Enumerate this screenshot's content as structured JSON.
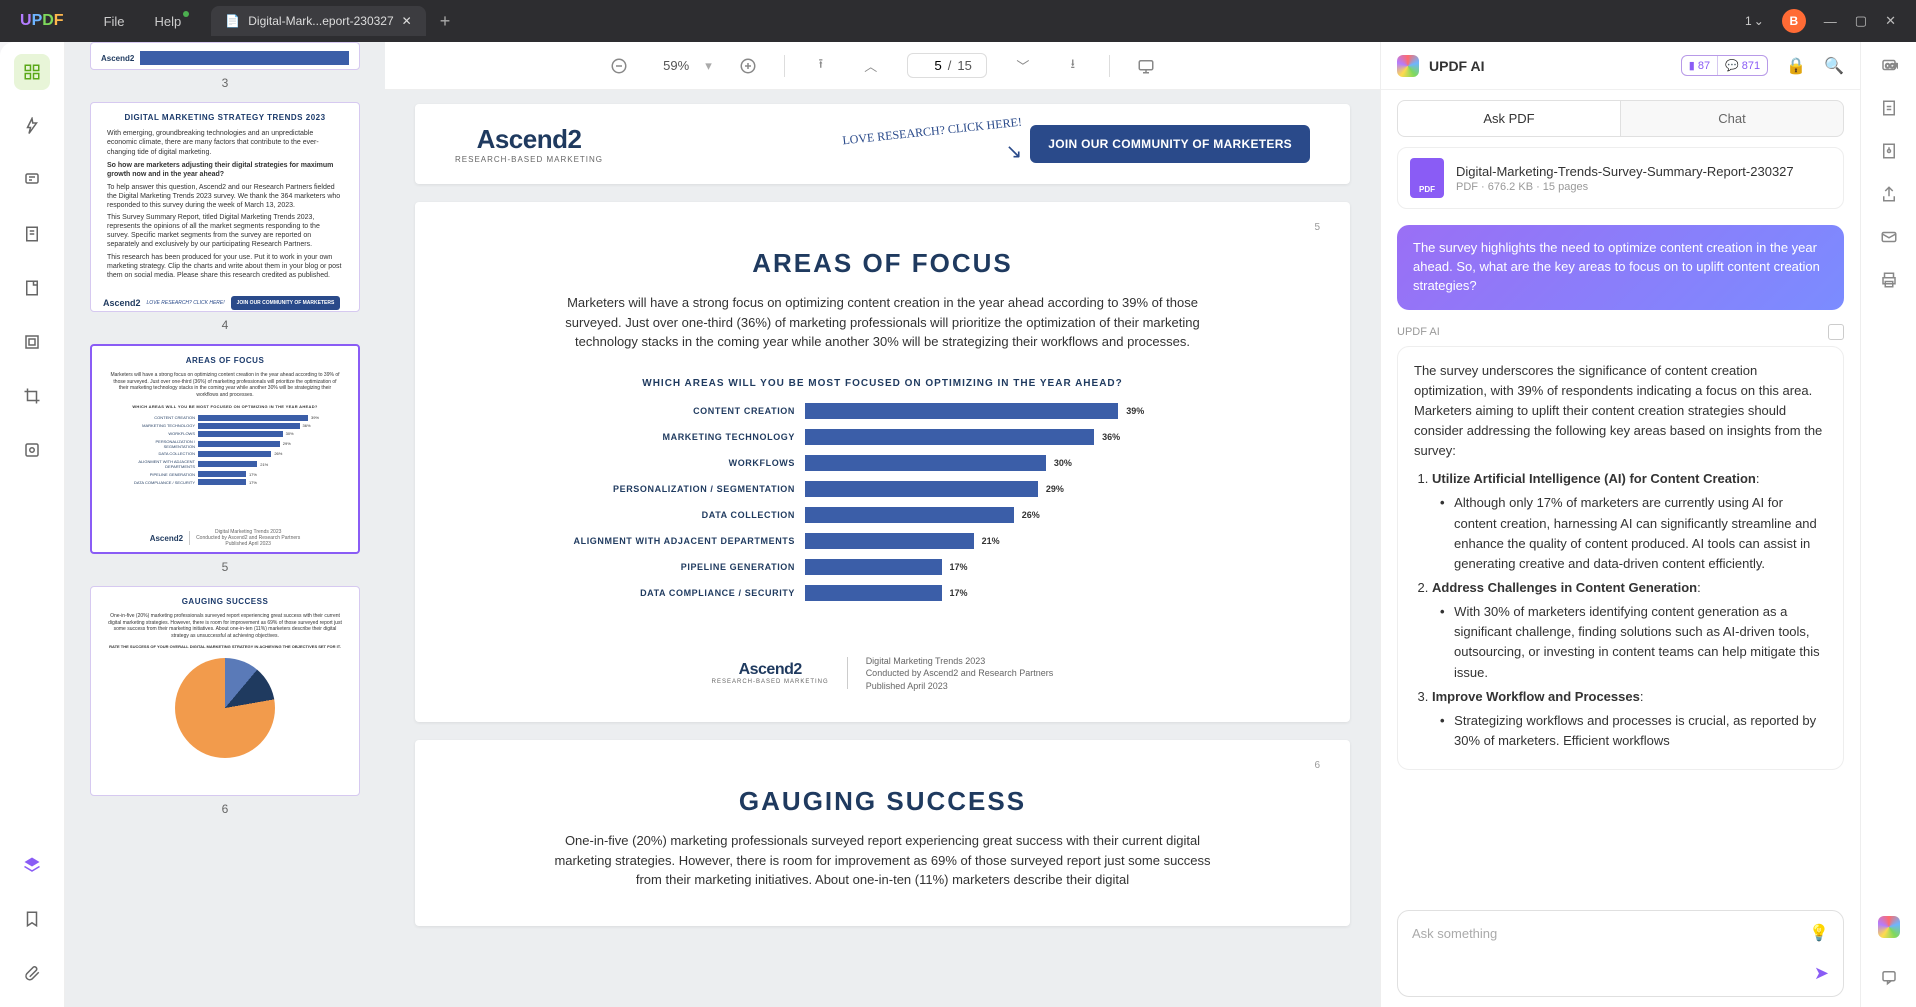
{
  "titlebar": {
    "menu": [
      "File",
      "Help"
    ],
    "tab_name": "Digital-Mark...eport-230327",
    "badge_num": "1",
    "avatar": "B"
  },
  "toolbar": {
    "zoom": "59%",
    "page_current": "5",
    "page_total": "15"
  },
  "thumbs": [
    {
      "num": "3"
    },
    {
      "num": "4",
      "title": "DIGITAL MARKETING STRATEGY TRENDS 2023"
    },
    {
      "num": "5",
      "title": "AREAS OF FOCUS"
    },
    {
      "num": "6",
      "title": "GAUGING SUCCESS"
    }
  ],
  "doc": {
    "ascend_name": "Ascend2",
    "ascend_sub": "RESEARCH-BASED MARKETING",
    "cta_script": "LOVE RESEARCH? CLICK HERE!",
    "cta_button": "JOIN OUR COMMUNITY OF MARKETERS",
    "page5": {
      "num": "5",
      "title": "AREAS OF FOCUS",
      "body": "Marketers will have a strong focus on optimizing content creation in the year ahead according to 39% of those surveyed. Just over one-third (36%) of marketing professionals will prioritize the optimization of their marketing technology stacks in the coming year while another 30% will be strategizing their workflows and processes.",
      "chart_title": "WHICH AREAS WILL YOU BE MOST FOCUSED ON OPTIMIZING IN THE YEAR AHEAD?",
      "footer": {
        "l1": "Digital Marketing Trends 2023",
        "l2": "Conducted by Ascend2 and Research Partners",
        "l3": "Published April 2023"
      }
    },
    "page6": {
      "num": "6",
      "title": "GAUGING SUCCESS",
      "body": "One-in-five (20%) marketing professionals surveyed report experiencing great success with their current digital marketing strategies. However, there is room for improvement as 69% of those surveyed report just some success from their marketing initiatives. About one-in-ten (11%) marketers describe their digital"
    }
  },
  "chart_data": {
    "type": "bar",
    "orientation": "horizontal",
    "title": "WHICH AREAS WILL YOU BE MOST FOCUSED ON OPTIMIZING IN THE YEAR AHEAD?",
    "categories": [
      "CONTENT CREATION",
      "MARKETING TECHNOLOGY",
      "WORKFLOWS",
      "PERSONALIZATION / SEGMENTATION",
      "DATA COLLECTION",
      "ALIGNMENT WITH ADJACENT DEPARTMENTS",
      "PIPELINE GENERATION",
      "DATA COMPLIANCE / SECURITY"
    ],
    "values": [
      39,
      36,
      30,
      29,
      26,
      21,
      17,
      17
    ],
    "value_labels": [
      "39%",
      "36%",
      "30%",
      "29%",
      "26%",
      "21%",
      "17%",
      "17%"
    ],
    "xlabel": "",
    "ylabel": "",
    "xlim": [
      0,
      40
    ]
  },
  "ai": {
    "title": "UPDF AI",
    "credit1": "87",
    "credit2": "871",
    "tabs": [
      "Ask PDF",
      "Chat"
    ],
    "file_name": "Digital-Marketing-Trends-Survey-Summary-Report-230327",
    "file_meta": "PDF · 676.2 KB · 15 pages",
    "user_msg": "The survey highlights the need to optimize content creation in the year ahead. So, what are the key areas to focus on to uplift content creation strategies?",
    "ai_label": "UPDF AI",
    "ai_intro": "The survey underscores the significance of content creation optimization, with 39% of respondents indicating a focus on this area. Marketers aiming to uplift their content creation strategies should consider addressing the following key areas based on insights from the survey:",
    "points": [
      {
        "title": "Utilize Artificial Intelligence (AI) for Content Creation",
        "body": "Although only 17% of marketers are currently using AI for content creation, harnessing AI can significantly streamline and enhance the quality of content produced. AI tools can assist in generating creative and data-driven content efficiently."
      },
      {
        "title": "Address Challenges in Content Generation",
        "body": "With 30% of marketers identifying content generation as a significant challenge, finding solutions such as AI-driven tools, outsourcing, or investing in content teams can help mitigate this issue."
      },
      {
        "title": "Improve Workflow and Processes",
        "body": "Strategizing workflows and processes is crucial, as reported by 30% of marketers. Efficient workflows"
      }
    ],
    "placeholder": "Ask something"
  }
}
